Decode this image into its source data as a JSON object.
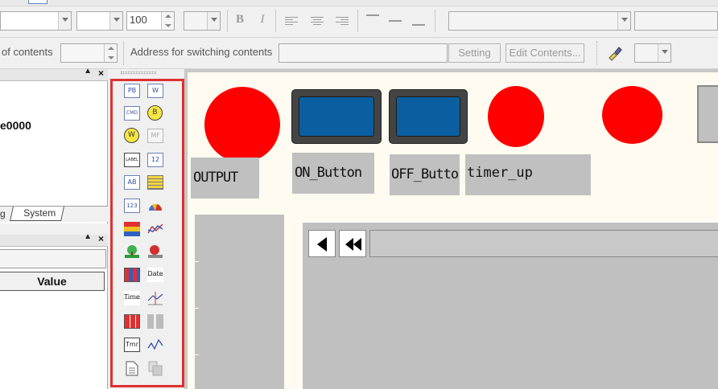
{
  "toolbar1": {
    "font_size_value": "100",
    "bold_label": "B",
    "italic_label": "I"
  },
  "toolbar2": {
    "contents_label": "of contents",
    "address_label": "Address for switching contents",
    "setting_button": "Setting",
    "edit_contents_button": "Edit Contents..."
  },
  "left_panel": {
    "item_partial": "e0000",
    "tab_partial": "g",
    "tab_system": "System",
    "value_header": "Value"
  },
  "canvas": {
    "labels": {
      "output": "OUTPUT",
      "on_button": "ON_Button",
      "off_button": "OFF_Butto",
      "timer_up": "timer_up"
    }
  },
  "palette": {
    "items": [
      "PB",
      "W",
      "CMD",
      "B",
      "W",
      "MF",
      "LABEL",
      "12",
      "AB",
      "123",
      "Date",
      "Time",
      "Tmr"
    ]
  },
  "colors": {
    "canvas_bg": "#fffbf0",
    "lamp_red": "#ff0000",
    "button_blue": "#0b5fa0",
    "highlight_red": "#e03030",
    "label_gray": "#c0c0c0"
  }
}
